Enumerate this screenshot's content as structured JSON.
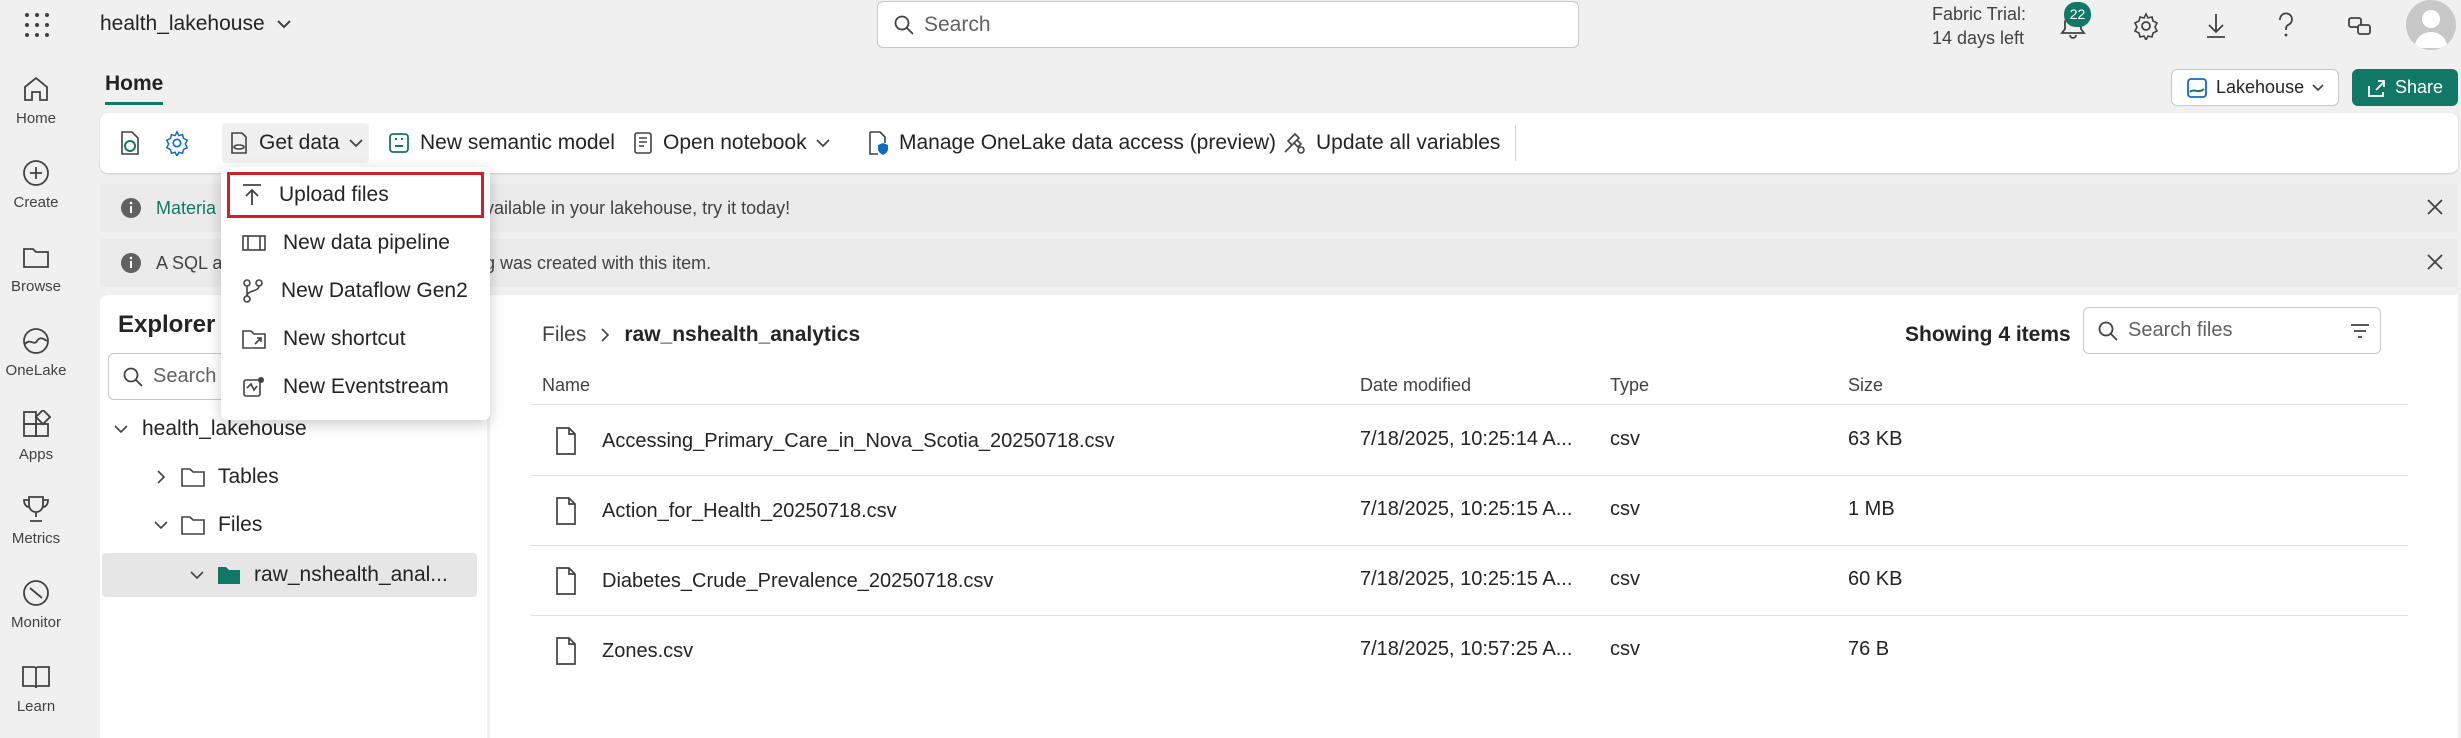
{
  "topbar": {
    "workspace": "health_lakehouse",
    "search_placeholder": "Search",
    "trial_line1": "Fabric Trial:",
    "trial_line2": "14 days left",
    "notifications_count": "22"
  },
  "leftnav": [
    {
      "label": "Home",
      "icon": "home-icon"
    },
    {
      "label": "Create",
      "icon": "create-icon"
    },
    {
      "label": "Browse",
      "icon": "browse-icon"
    },
    {
      "label": "OneLake",
      "icon": "onelake-icon"
    },
    {
      "label": "Apps",
      "icon": "apps-icon"
    },
    {
      "label": "Metrics",
      "icon": "metrics-icon"
    },
    {
      "label": "Monitor",
      "icon": "monitor-icon"
    },
    {
      "label": "Learn",
      "icon": "learn-icon"
    }
  ],
  "header": {
    "tab_home": "Home",
    "lakehouse_label": "Lakehouse",
    "share_label": "Share"
  },
  "ribbon": {
    "get_data": "Get data",
    "new_semantic_model": "New semantic model",
    "open_notebook": "Open notebook",
    "manage_onelake": "Manage OneLake data access (preview)",
    "update_variables": "Update all variables"
  },
  "banners": [
    {
      "text_start": "Materia",
      "text_end": "vailable in your lakehouse, try it today!"
    },
    {
      "text_start": "A SQL a",
      "text_end": "g was created with this item."
    }
  ],
  "dropdown": {
    "items": [
      "Upload files",
      "New data pipeline",
      "New Dataflow Gen2",
      "New shortcut",
      "New Eventstream"
    ]
  },
  "explorer": {
    "title": "Explorer",
    "search_placeholder": "Search",
    "root": "health_lakehouse",
    "tables": "Tables",
    "files": "Files",
    "selected_folder": "raw_nshealth_anal..."
  },
  "content": {
    "crumb_root": "Files",
    "crumb_current": "raw_nshealth_analytics",
    "showing": "Showing 4 items",
    "search_placeholder": "Search files",
    "columns": {
      "name": "Name",
      "date": "Date modified",
      "type": "Type",
      "size": "Size"
    },
    "rows": [
      {
        "name": "Accessing_Primary_Care_in_Nova_Scotia_20250718.csv",
        "date": "7/18/2025, 10:25:14 A...",
        "type": "csv",
        "size": "63 KB"
      },
      {
        "name": "Action_for_Health_20250718.csv",
        "date": "7/18/2025, 10:25:15 A...",
        "type": "csv",
        "size": "1 MB"
      },
      {
        "name": "Diabetes_Crude_Prevalence_20250718.csv",
        "date": "7/18/2025, 10:25:15 A...",
        "type": "csv",
        "size": "60 KB"
      },
      {
        "name": "Zones.csv",
        "date": "7/18/2025, 10:57:25 A...",
        "type": "csv",
        "size": "76 B"
      }
    ]
  },
  "colors": {
    "accent": "#117865",
    "highlight": "#d31f28"
  }
}
